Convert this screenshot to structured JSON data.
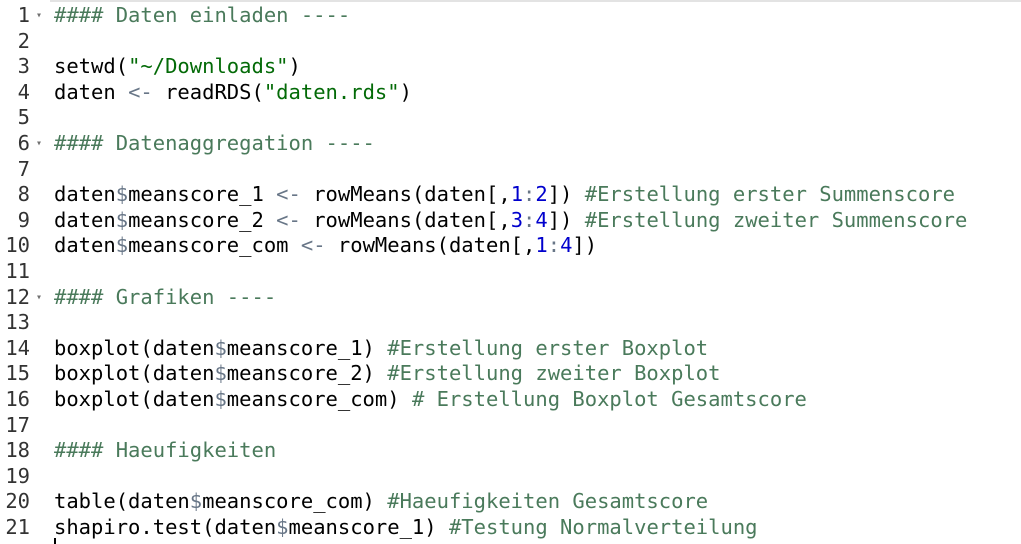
{
  "editor": {
    "fold_glyph": "▾",
    "lines": [
      {
        "n": "1",
        "fold": true,
        "tokens": [
          [
            "c",
            "#### Daten einladen ----"
          ]
        ]
      },
      {
        "n": "2",
        "fold": false,
        "tokens": []
      },
      {
        "n": "3",
        "fold": false,
        "tokens": [
          [
            "t",
            "setwd("
          ],
          [
            "s",
            "\"~/Downloads\""
          ],
          [
            "t",
            ")"
          ]
        ]
      },
      {
        "n": "4",
        "fold": false,
        "tokens": [
          [
            "t",
            "daten "
          ],
          [
            "o",
            "<-"
          ],
          [
            "t",
            " readRDS("
          ],
          [
            "s",
            "\"daten.rds\""
          ],
          [
            "t",
            ")"
          ]
        ]
      },
      {
        "n": "5",
        "fold": false,
        "tokens": []
      },
      {
        "n": "6",
        "fold": true,
        "tokens": [
          [
            "c",
            "#### Datenaggregation ----"
          ]
        ]
      },
      {
        "n": "7",
        "fold": false,
        "tokens": []
      },
      {
        "n": "8",
        "fold": false,
        "tokens": [
          [
            "t",
            "daten"
          ],
          [
            "o",
            "$"
          ],
          [
            "t",
            "meanscore_1 "
          ],
          [
            "o",
            "<-"
          ],
          [
            "t",
            " rowMeans(daten[,"
          ],
          [
            "n",
            "1"
          ],
          [
            "o",
            ":"
          ],
          [
            "n",
            "2"
          ],
          [
            "t",
            "]) "
          ],
          [
            "c",
            "#Erstellung erster Summenscore"
          ]
        ]
      },
      {
        "n": "9",
        "fold": false,
        "tokens": [
          [
            "t",
            "daten"
          ],
          [
            "o",
            "$"
          ],
          [
            "t",
            "meanscore_2 "
          ],
          [
            "o",
            "<-"
          ],
          [
            "t",
            " rowMeans(daten[,"
          ],
          [
            "n",
            "3"
          ],
          [
            "o",
            ":"
          ],
          [
            "n",
            "4"
          ],
          [
            "t",
            "]) "
          ],
          [
            "c",
            "#Erstellung zweiter Summenscore"
          ]
        ]
      },
      {
        "n": "10",
        "fold": false,
        "tokens": [
          [
            "t",
            "daten"
          ],
          [
            "o",
            "$"
          ],
          [
            "t",
            "meanscore_com "
          ],
          [
            "o",
            "<-"
          ],
          [
            "t",
            " rowMeans(daten[,"
          ],
          [
            "n",
            "1"
          ],
          [
            "o",
            ":"
          ],
          [
            "n",
            "4"
          ],
          [
            "t",
            "])"
          ]
        ]
      },
      {
        "n": "11",
        "fold": false,
        "tokens": []
      },
      {
        "n": "12",
        "fold": true,
        "tokens": [
          [
            "c",
            "#### Grafiken ----"
          ]
        ]
      },
      {
        "n": "13",
        "fold": false,
        "tokens": []
      },
      {
        "n": "14",
        "fold": false,
        "tokens": [
          [
            "t",
            "boxplot(daten"
          ],
          [
            "o",
            "$"
          ],
          [
            "t",
            "meanscore_1) "
          ],
          [
            "c",
            "#Erstellung erster Boxplot"
          ]
        ]
      },
      {
        "n": "15",
        "fold": false,
        "tokens": [
          [
            "t",
            "boxplot(daten"
          ],
          [
            "o",
            "$"
          ],
          [
            "t",
            "meanscore_2) "
          ],
          [
            "c",
            "#Erstellung zweiter Boxplot"
          ]
        ]
      },
      {
        "n": "16",
        "fold": false,
        "tokens": [
          [
            "t",
            "boxplot(daten"
          ],
          [
            "o",
            "$"
          ],
          [
            "t",
            "meanscore_com) "
          ],
          [
            "c",
            "# Erstellung Boxplot Gesamtscore"
          ]
        ]
      },
      {
        "n": "17",
        "fold": false,
        "tokens": []
      },
      {
        "n": "18",
        "fold": false,
        "tokens": [
          [
            "c",
            "#### Haeufigkeiten"
          ]
        ]
      },
      {
        "n": "19",
        "fold": false,
        "tokens": []
      },
      {
        "n": "20",
        "fold": false,
        "tokens": [
          [
            "t",
            "table(daten"
          ],
          [
            "o",
            "$"
          ],
          [
            "t",
            "meanscore_com) "
          ],
          [
            "c",
            "#Haeufigkeiten Gesamtscore"
          ]
        ]
      },
      {
        "n": "21",
        "fold": false,
        "tokens": [
          [
            "t",
            "shapiro.test(daten"
          ],
          [
            "o",
            "$"
          ],
          [
            "t",
            "meanscore_1) "
          ],
          [
            "c",
            "#Testung Normalverteilung"
          ]
        ]
      }
    ]
  }
}
